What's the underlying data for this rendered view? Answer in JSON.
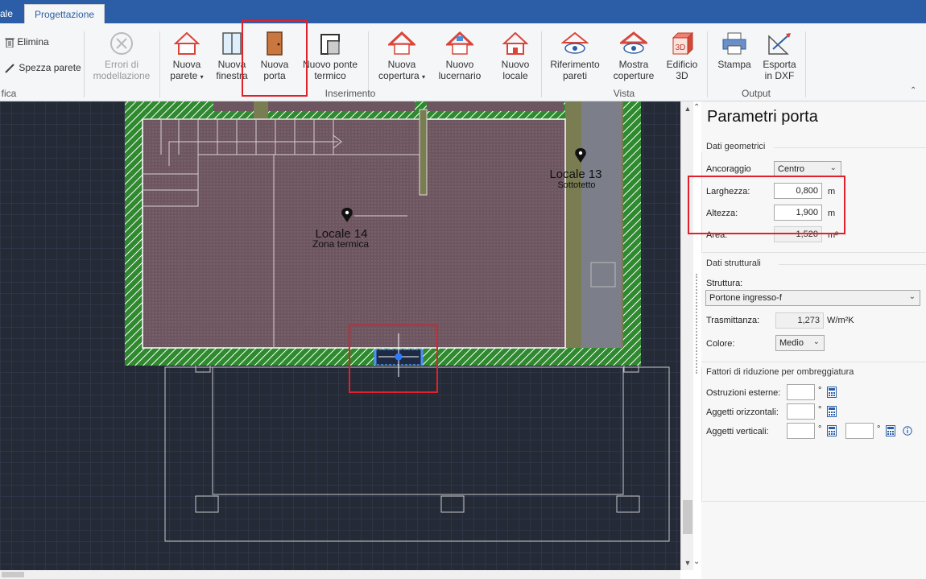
{
  "tabs": {
    "prev_label": "ale",
    "active_label": "Progettazione"
  },
  "ribbon": {
    "elimina": "Elimina",
    "spezza_parete": "Spezza parete",
    "errori_line1": "Errori di",
    "errori_line2": "modellazione",
    "left_group_label": "fica",
    "nuova_parete_line1": "Nuova",
    "nuova_parete_line2": "parete",
    "nuova_finestra_line1": "Nuova",
    "nuova_finestra_line2": "finestra",
    "nuova_porta_line1": "Nuova",
    "nuova_porta_line2": "porta",
    "ponte_line1": "Nuovo ponte",
    "ponte_line2": "termico",
    "copertura_line1": "Nuova",
    "copertura_line2": "copertura",
    "lucernario_line1": "Nuovo",
    "lucernario_line2": "lucernario",
    "locale_line1": "Nuovo",
    "locale_line2": "locale",
    "inserimento_label": "Inserimento",
    "rif_pareti_line1": "Riferimento",
    "rif_pareti_line2": "pareti",
    "mostra_cop_line1": "Mostra",
    "mostra_cop_line2": "coperture",
    "edificio_line1": "Edificio",
    "edificio_line2": "3D",
    "vista_label": "Vista",
    "stampa": "Stampa",
    "esporta_line1": "Esporta",
    "esporta_line2": "in DXF",
    "output_label": "Output",
    "icon_3d_text": "3D"
  },
  "drawing": {
    "room14_name": "Locale 14",
    "room14_sub": "Zona termica",
    "room13_name": "Locale 13",
    "room13_sub": "Sottotetto"
  },
  "panel": {
    "title": "Parametri porta",
    "geom_section": "Dati geometrici",
    "ancoraggio_label": "Ancoraggio",
    "ancoraggio_value": "Centro",
    "larghezza_label": "Larghezza:",
    "larghezza_value": "0,800",
    "altezza_label": "Altezza:",
    "altezza_value": "1,900",
    "area_label": "Area:",
    "area_value": "1,520",
    "unit_m": "m",
    "unit_m2": "m²",
    "struct_section": "Dati strutturali",
    "struttura_label": "Struttura:",
    "struttura_value": "Portone ingresso-f",
    "trasmittanza_label": "Trasmittanza:",
    "trasmittanza_value": "1,273",
    "trasmittanza_unit": "W/m²K",
    "colore_label": "Colore:",
    "colore_value": "Medio",
    "shade_section": "Fattori di riduzione per ombreggiatura",
    "ostruzioni_label": "Ostruzioni esterne:",
    "orizzontali_label": "Aggetti orizzontali:",
    "verticali_label": "Aggetti verticali:",
    "degree": "°"
  },
  "colors": {
    "accent": "#2c5ea7",
    "highlight": "#e0202a",
    "wall": "#2f8a2f",
    "room": "#6e5660",
    "canvas": "#252a37"
  }
}
